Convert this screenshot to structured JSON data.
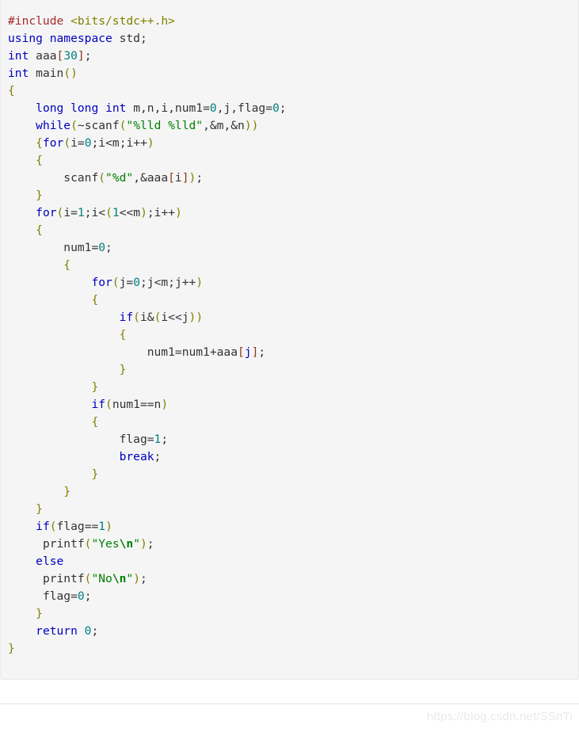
{
  "code_block": {
    "language": "cpp",
    "background_color": "#f5f5f5",
    "border_color": "#e8e8e8",
    "text_color": "#333333",
    "lines": [
      "#include <bits/stdc++.h>",
      "using namespace std;",
      "int aaa[30];",
      "int main()",
      "{",
      "    long long int m,n,i,num1=0,j,flag=0;",
      "    while(~scanf(\"%lld %lld\",&m,&n))",
      "    {for(i=0;i<m;i++)",
      "    {",
      "        scanf(\"%d\",&aaa[i]);",
      "    }",
      "    for(i=1;i<(1<<m);i++)",
      "    {",
      "        num1=0;",
      "        {",
      "            for(j=0;j<m;j++)",
      "            {",
      "                if(i&(i<<j))",
      "                {",
      "                    num1=num1+aaa[j];",
      "                }",
      "            }",
      "            if(num1==n)",
      "            {",
      "                flag=1;",
      "                break;",
      "            }",
      "        }",
      "    }",
      "    if(flag==1)",
      "     printf(\"Yes\\n\");",
      "    else",
      "     printf(\"No\\n\");",
      "     flag=0;",
      "    }",
      "    return 0;",
      "}"
    ],
    "syntax_colors": {
      "keyword": "#0000c0",
      "preprocessor": "#a52a2a",
      "header_name": "#808000",
      "string": "#008000",
      "number": "#008080",
      "punctuation": "#808000",
      "bracket": "#8b3a1a",
      "identifier": "#333333"
    }
  },
  "watermark": {
    "text": "https://blog.csdn.net/SSnTi",
    "color": "#eaeaea"
  }
}
